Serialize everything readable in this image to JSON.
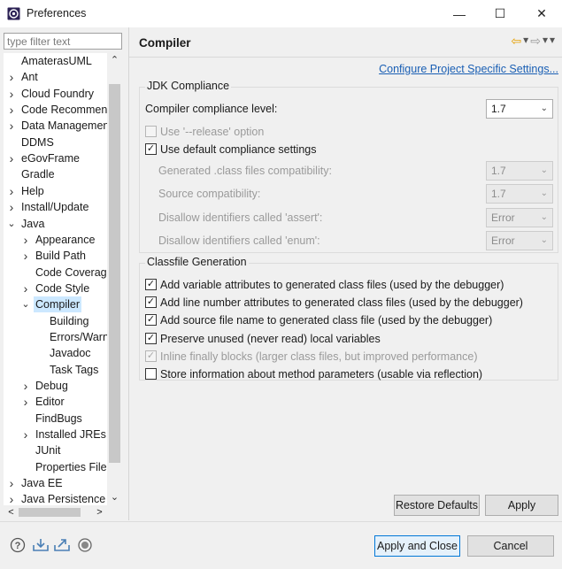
{
  "window": {
    "title": "Preferences",
    "minimize_glyph": "—",
    "maximize_glyph": "☐",
    "close_glyph": "✕"
  },
  "filter": {
    "placeholder": "type filter text",
    "value": ""
  },
  "tree": {
    "items": [
      {
        "label": "AmaterasUML",
        "arrow": "",
        "level": 0
      },
      {
        "label": "Ant",
        "arrow": ">",
        "level": 0
      },
      {
        "label": "Cloud Foundry",
        "arrow": ">",
        "level": 0
      },
      {
        "label": "Code Recommenders",
        "arrow": ">",
        "level": 0
      },
      {
        "label": "Data Management",
        "arrow": ">",
        "level": 0
      },
      {
        "label": "DDMS",
        "arrow": "",
        "level": 0
      },
      {
        "label": "eGovFrame",
        "arrow": ">",
        "level": 0
      },
      {
        "label": "Gradle",
        "arrow": "",
        "level": 0
      },
      {
        "label": "Help",
        "arrow": ">",
        "level": 0
      },
      {
        "label": "Install/Update",
        "arrow": ">",
        "level": 0
      },
      {
        "label": "Java",
        "arrow": "v",
        "level": 0
      },
      {
        "label": "Appearance",
        "arrow": ">",
        "level": 1
      },
      {
        "label": "Build Path",
        "arrow": ">",
        "level": 1
      },
      {
        "label": "Code Coverage",
        "arrow": "",
        "level": 1
      },
      {
        "label": "Code Style",
        "arrow": ">",
        "level": 1
      },
      {
        "label": "Compiler",
        "arrow": "v",
        "level": 1,
        "selected": true
      },
      {
        "label": "Building",
        "arrow": "",
        "level": 2
      },
      {
        "label": "Errors/Warnings",
        "arrow": "",
        "level": 2
      },
      {
        "label": "Javadoc",
        "arrow": "",
        "level": 2
      },
      {
        "label": "Task Tags",
        "arrow": "",
        "level": 2
      },
      {
        "label": "Debug",
        "arrow": ">",
        "level": 1
      },
      {
        "label": "Editor",
        "arrow": ">",
        "level": 1
      },
      {
        "label": "FindBugs",
        "arrow": "",
        "level": 1
      },
      {
        "label": "Installed JREs",
        "arrow": ">",
        "level": 1
      },
      {
        "label": "JUnit",
        "arrow": "",
        "level": 1
      },
      {
        "label": "Properties Files Editor",
        "arrow": "",
        "level": 1
      },
      {
        "label": "Java EE",
        "arrow": ">",
        "level": 0
      },
      {
        "label": "Java Persistence",
        "arrow": ">",
        "level": 0
      }
    ]
  },
  "page": {
    "title": "Compiler",
    "configure_link": "Configure Project Specific Settings...",
    "jdk_group": {
      "title": "JDK Compliance",
      "compliance_label": "Compiler compliance level:",
      "compliance_value": "1.7",
      "release_option": {
        "label": "Use '--release' option",
        "checked": false,
        "enabled": false
      },
      "use_default": {
        "label": "Use default compliance settings",
        "checked": true,
        "enabled": true
      },
      "generated_label": "Generated .class files compatibility:",
      "generated_value": "1.7",
      "source_label": "Source compatibility:",
      "source_value": "1.7",
      "assert_label": "Disallow identifiers called 'assert':",
      "assert_value": "Error",
      "enum_label": "Disallow identifiers called 'enum':",
      "enum_value": "Error"
    },
    "classfile_group": {
      "title": "Classfile Generation",
      "options": [
        {
          "label": "Add variable attributes to generated class files (used by the debugger)",
          "checked": true,
          "enabled": true
        },
        {
          "label": "Add line number attributes to generated class files (used by the debugger)",
          "checked": true,
          "enabled": true
        },
        {
          "label": "Add source file name to generated class file (used by the debugger)",
          "checked": true,
          "enabled": true
        },
        {
          "label": "Preserve unused (never read) local variables",
          "checked": true,
          "enabled": true
        },
        {
          "label": "Inline finally blocks (larger class files, but improved performance)",
          "checked": true,
          "enabled": false
        },
        {
          "label": "Store information about method parameters (usable via reflection)",
          "checked": false,
          "enabled": true
        }
      ]
    },
    "restore_defaults": "Restore Defaults",
    "apply": "Apply"
  },
  "footer": {
    "apply_and_close": "Apply and Close",
    "cancel": "Cancel",
    "icons": [
      "help-icon",
      "import-icon",
      "export-icon",
      "record-icon"
    ]
  },
  "colors": {
    "link": "#1a5fb4",
    "accent": "#0078d7",
    "selection": "#cce8ff"
  }
}
